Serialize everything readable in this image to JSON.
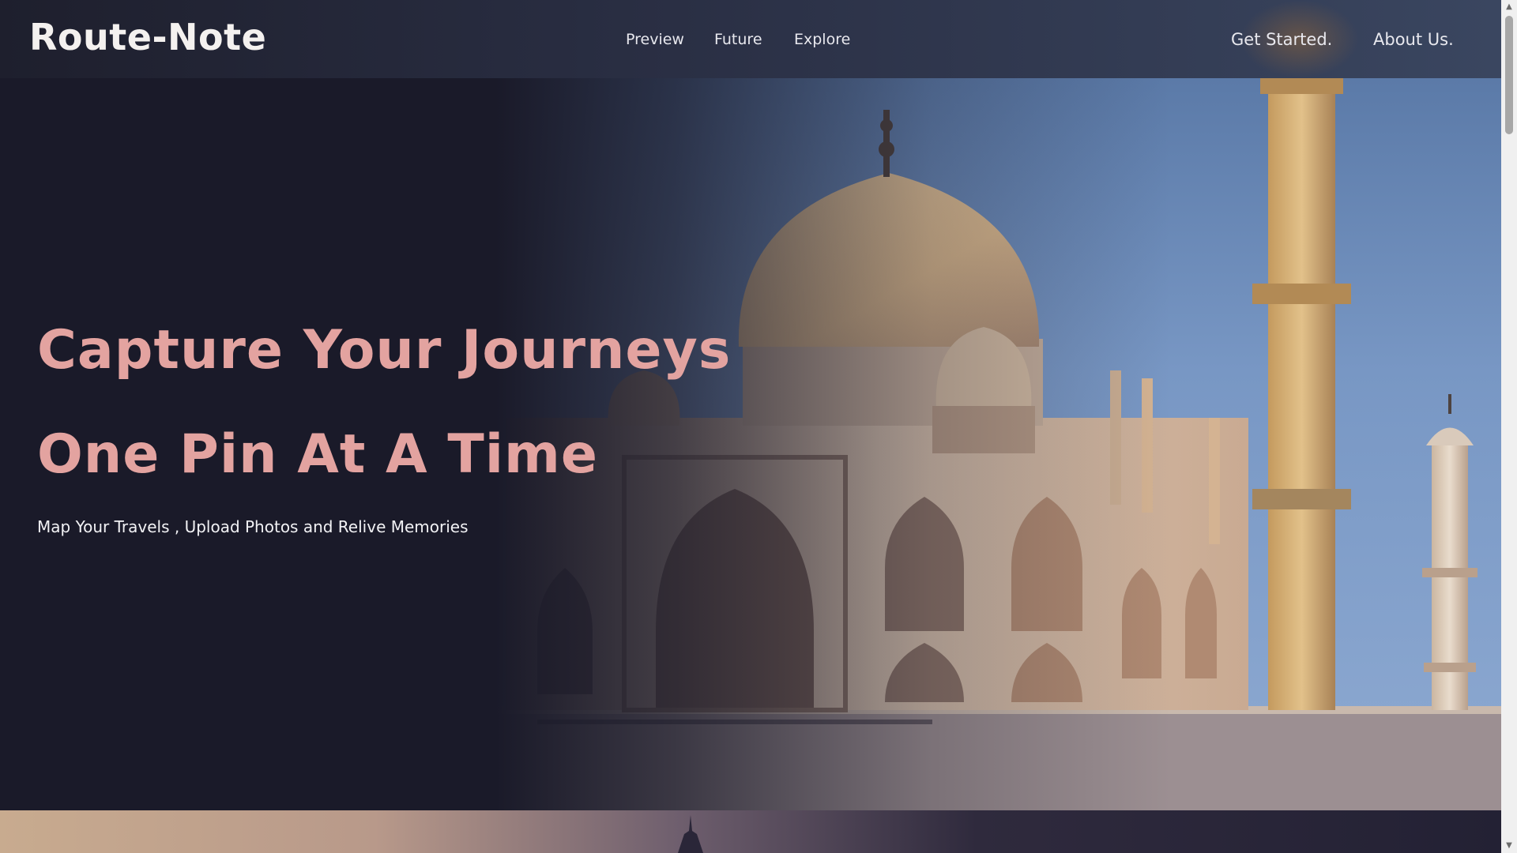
{
  "brand": {
    "logo": "Route-Note"
  },
  "nav": {
    "center": [
      "Preview",
      "Future",
      "Explore"
    ],
    "right": [
      "Get Started.",
      "About Us."
    ]
  },
  "hero": {
    "headline_line1": "Capture Your Journeys",
    "headline_line2": "One Pin At A Time",
    "subtitle": "Map Your Travels , Upload Photos and Relive Memories",
    "background_image": "taj-mahal-photo"
  },
  "colors": {
    "accent_headline": "#e3a3a0",
    "background": "#1a1a29",
    "nav_text": "#e8e8ee"
  },
  "scrollbar": {
    "up_arrow": "▲",
    "down_arrow": "▼"
  }
}
